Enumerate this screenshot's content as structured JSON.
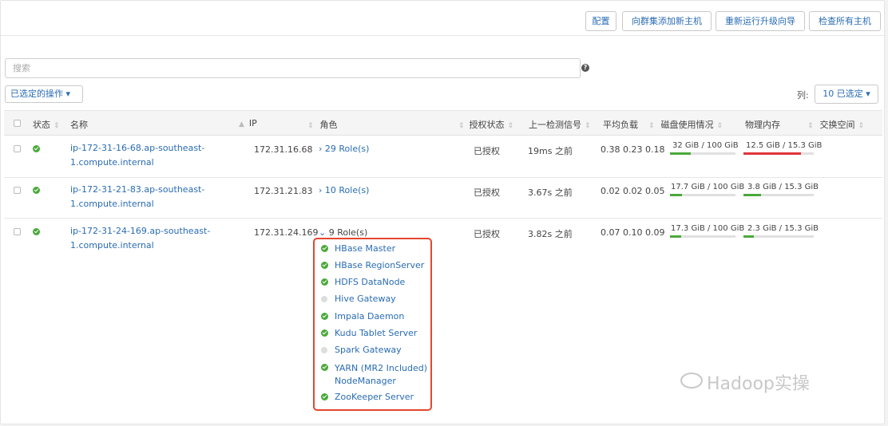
{
  "toolbar": {
    "config": "配置",
    "add_host": "向群集添加新主机",
    "rerun_wizard": "重新运行升级向导",
    "inspect_all": "检查所有主机"
  },
  "search": {
    "placeholder": "搜索"
  },
  "actions": {
    "selected_actions": "已选定的操作 ▾"
  },
  "columns": {
    "label": "列:",
    "selected": "10 已选定 ▾"
  },
  "table": {
    "headers": {
      "status": "状态",
      "name": "名称",
      "ip": "IP",
      "roles": "角色",
      "auth": "授权状态",
      "heartbeat": "上一检测信号",
      "load": "平均负载",
      "disk": "磁盘使用情况",
      "memory": "物理内存",
      "swap": "交换空间"
    },
    "rows": [
      {
        "name_line1": "ip-172-31-16-68.ap-southeast-",
        "name_line2": "1.compute.internal",
        "ip": "172.31.16.68",
        "roles": "29 Role(s)",
        "auth": "已授权",
        "heartbeat": "19ms 之前",
        "load": "0.38  0.23  0.18",
        "disk": "32 GiB / 100 GiB",
        "disk_fraction": 0.32,
        "memory": "12.5 GiB / 15.3 GiB",
        "memory_fraction": 0.817
      },
      {
        "name_line1": "ip-172-31-21-83.ap-southeast-",
        "name_line2": "1.compute.internal",
        "ip": "172.31.21.83",
        "roles": "10 Role(s)",
        "auth": "已授权",
        "heartbeat": "3.67s 之前",
        "load": "0.02  0.02  0.05",
        "disk": "17.7 GiB / 100 GiB",
        "disk_fraction": 0.177,
        "memory": "3.8 GiB / 15.3 GiB",
        "memory_fraction": 0.248
      },
      {
        "name_line1": "ip-172-31-24-169.ap-southeast-",
        "name_line2": "1.compute.internal",
        "ip": "172.31.24.169",
        "roles": "9 Role(s)",
        "auth": "已授权",
        "heartbeat": "3.82s 之前",
        "load": "0.07  0.10  0.09",
        "disk": "17.3 GiB / 100 GiB",
        "disk_fraction": 0.173,
        "memory": "2.3 GiB / 15.3 GiB",
        "memory_fraction": 0.15
      }
    ],
    "expanded_roles": [
      {
        "name": "HBase Master",
        "status": "ok"
      },
      {
        "name": "HBase RegionServer",
        "status": "ok"
      },
      {
        "name": "HDFS DataNode",
        "status": "ok"
      },
      {
        "name": "Hive Gateway",
        "status": "none"
      },
      {
        "name": "Impala Daemon",
        "status": "ok"
      },
      {
        "name": "Kudu Tablet Server",
        "status": "ok"
      },
      {
        "name": "Spark Gateway",
        "status": "none"
      },
      {
        "name": "YARN (MR2 Included)",
        "name2": "NodeManager",
        "status": "ok"
      },
      {
        "name": "ZooKeeper Server",
        "status": "ok"
      }
    ]
  },
  "colors": {
    "link": "#2a6cb3",
    "ok": "#4aa93a",
    "bar_green": "#4aa93a",
    "bar_red": "#e0343c",
    "highlight_box": "#e3472e"
  },
  "watermark": "Hadoop实操"
}
